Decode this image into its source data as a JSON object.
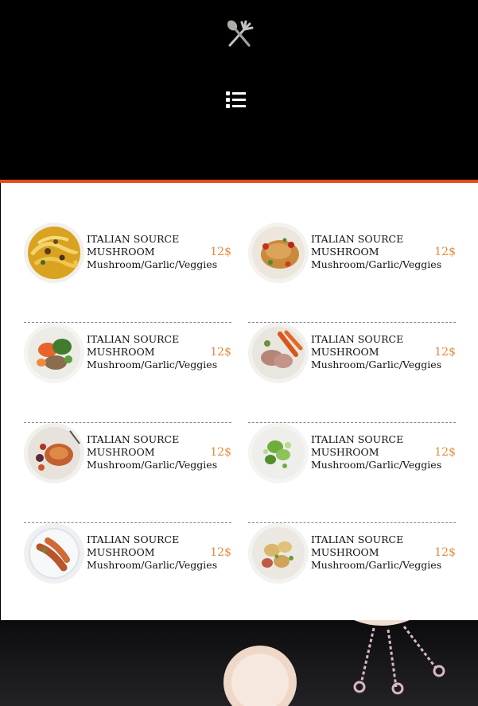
{
  "header": {
    "logo_icon": "fork-spoon-icon",
    "menu_icon": "list-menu-icon"
  },
  "colors": {
    "accent": "#e8481c",
    "price": "#e38a3a"
  },
  "menu_items": [
    {
      "name_line1": "ITALIAN SOURCE",
      "name_line2": "MUSHROOM",
      "description": "Mushroom/Garlic/Veggies",
      "price": "12$",
      "image": "pasta-dish"
    },
    {
      "name_line1": "ITALIAN SOURCE",
      "name_line2": "MUSHROOM",
      "description": "Mushroom/Garlic/Veggies",
      "price": "12$",
      "image": "chicken-dish"
    },
    {
      "name_line1": "ITALIAN SOURCE",
      "name_line2": "MUSHROOM",
      "description": "Mushroom/Garlic/Veggies",
      "price": "12$",
      "image": "salad-dish"
    },
    {
      "name_line1": "ITALIAN SOURCE",
      "name_line2": "MUSHROOM",
      "description": "Mushroom/Garlic/Veggies",
      "price": "12$",
      "image": "pork-carrot-dish"
    },
    {
      "name_line1": "ITALIAN SOURCE",
      "name_line2": "MUSHROOM",
      "description": "Mushroom/Garlic/Veggies",
      "price": "12$",
      "image": "roast-dish"
    },
    {
      "name_line1": "ITALIAN SOURCE",
      "name_line2": "MUSHROOM",
      "description": "Mushroom/Garlic/Veggies",
      "price": "12$",
      "image": "greens-dish"
    },
    {
      "name_line1": "ITALIAN SOURCE",
      "name_line2": "MUSHROOM",
      "description": "Mushroom/Garlic/Veggies",
      "price": "12$",
      "image": "sausage-dish"
    },
    {
      "name_line1": "ITALIAN SOURCE",
      "name_line2": "MUSHROOM",
      "description": "Mushroom/Garlic/Veggies",
      "price": "12$",
      "image": "potato-dish"
    }
  ]
}
